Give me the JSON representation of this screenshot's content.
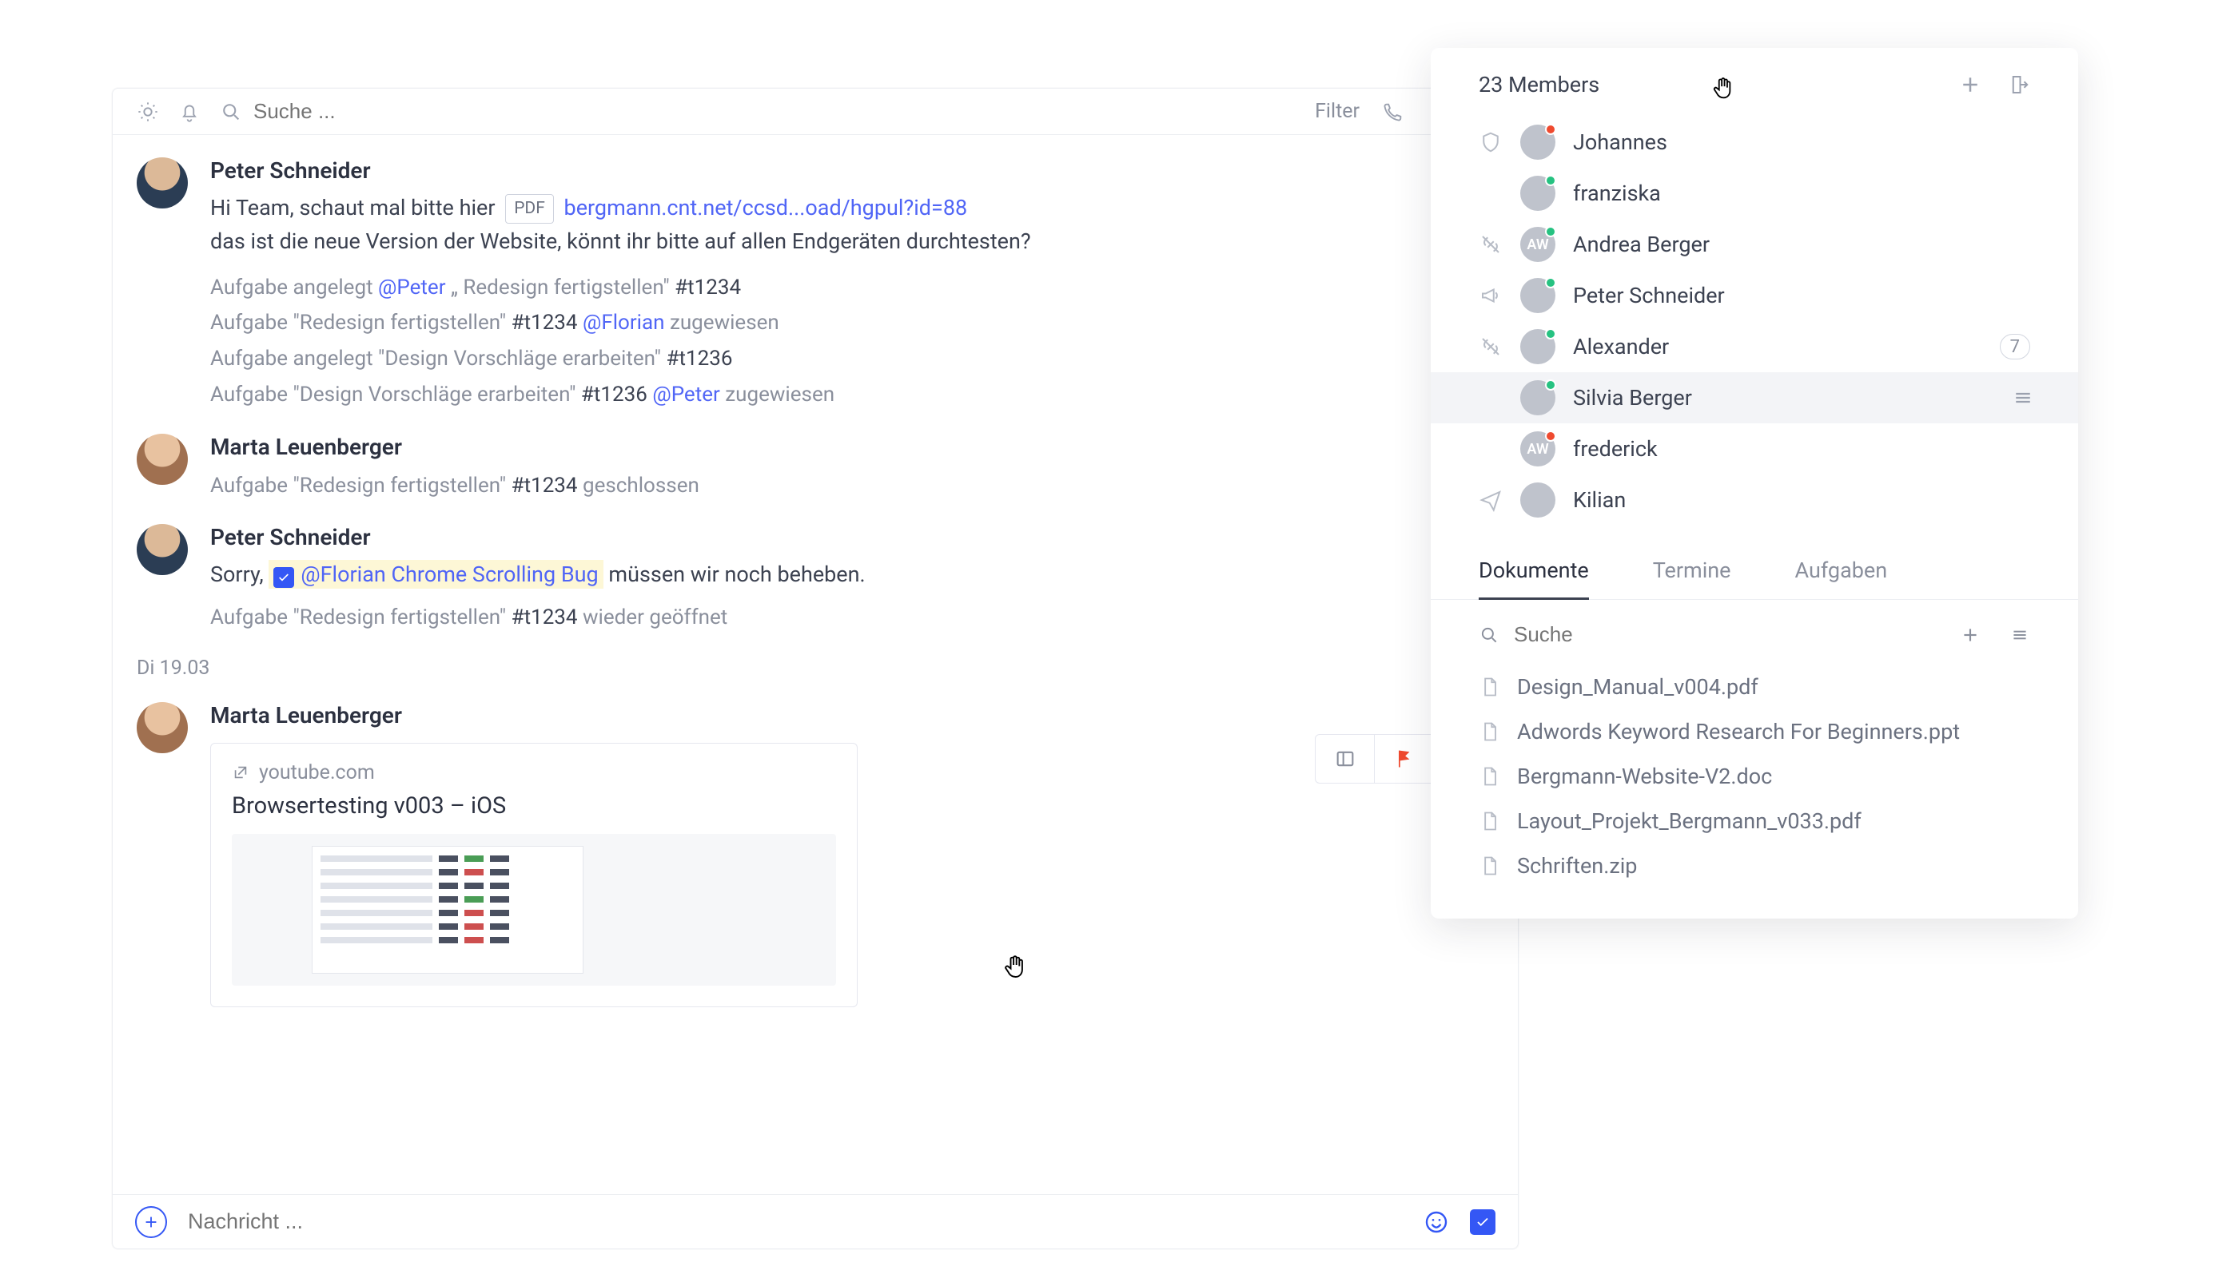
{
  "topbar": {
    "search_placeholder": "Suche ...",
    "filter_label": "Filter"
  },
  "chat": {
    "messages": [
      {
        "author": "Peter Schneider",
        "line1_pre": "Hi Team, schaut mal bitte hier",
        "pdf_chip": "PDF",
        "link": "bergmann.cnt.net/ccsd...oad/hgpul?id=88",
        "line2": "das ist die neue Version der Website, könnt ihr bitte auf allen Endgeräten durchtesten?",
        "meta": [
          {
            "pre": "Aufgabe angelegt ",
            "mention": "@Peter",
            "mid": " „ Redesign fertigstellen\" ",
            "tag": "#t1234",
            "post": ""
          },
          {
            "pre": "Aufgabe \"Redesign fertigstellen\" ",
            "tag": "#t1234",
            "mid": " ",
            "mention": "@Florian",
            "post": " zugewiesen"
          },
          {
            "pre": "Aufgabe angelegt \"Design Vorschläge erarbeiten\" ",
            "tag": "#t1236",
            "mid": "",
            "mention": "",
            "post": ""
          },
          {
            "pre": "Aufgabe \"Design Vorschläge erarbeiten\" ",
            "tag": "#t1236",
            "mid": " ",
            "mention": "@Peter",
            "post": " zugewiesen"
          }
        ]
      },
      {
        "author": "Marta Leuenberger",
        "meta_pre": "Aufgabe \"Redesign fertigstellen\" ",
        "meta_tag": "#t1234",
        "meta_post": " geschlossen"
      },
      {
        "author": "Peter Schneider",
        "sorry_pre": "Sorry, ",
        "hl_mention": "@Florian Chrome Scrolling Bug",
        "sorry_post": " müssen wir noch beheben.",
        "meta_pre": "Aufgabe \"Redesign fertigstellen\" ",
        "meta_tag": "#t1234",
        "meta_post": " wieder geöffnet"
      }
    ],
    "date_sep": "Di 19.03",
    "preview_msg": {
      "author": "Marta Leuenberger",
      "source": "youtube.com",
      "title": "Browsertesting v003 – iOS"
    }
  },
  "compose": {
    "placeholder": "Nachricht ..."
  },
  "panel": {
    "title": "23 Members",
    "members": [
      {
        "role": "shield",
        "name": "Johannes",
        "dot": "red",
        "av": "face-m1"
      },
      {
        "role": "",
        "name": "franziska",
        "dot": "green",
        "av": "face-f1"
      },
      {
        "role": "nolink",
        "name": "Andrea Berger",
        "dot": "green",
        "av": "aw",
        "initials": "AW"
      },
      {
        "role": "mega",
        "name": "Peter Schneider",
        "dot": "green",
        "av": "face-m2"
      },
      {
        "role": "nolink",
        "name": "Alexander",
        "dot": "green",
        "av": "face-m3",
        "badge": "7"
      },
      {
        "role": "",
        "name": "Silvia Berger",
        "dot": "green",
        "av": "face-f2",
        "selected": true,
        "more": true
      },
      {
        "role": "",
        "name": "frederick",
        "dot": "red",
        "av": "aw",
        "initials": "AW"
      },
      {
        "role": "send",
        "name": "Kilian",
        "dot": "",
        "av": "face-m1"
      }
    ],
    "tabs": {
      "t1": "Dokumente",
      "t2": "Termine",
      "t3": "Aufgaben"
    },
    "doc_search_placeholder": "Suche",
    "docs": [
      "Design_Manual_v004.pdf",
      "Adwords Keyword Research For Beginners.ppt",
      "Bergmann-Website-V2.doc",
      "Layout_Projekt_Bergmann_v033.pdf",
      "Schriften.zip"
    ]
  }
}
